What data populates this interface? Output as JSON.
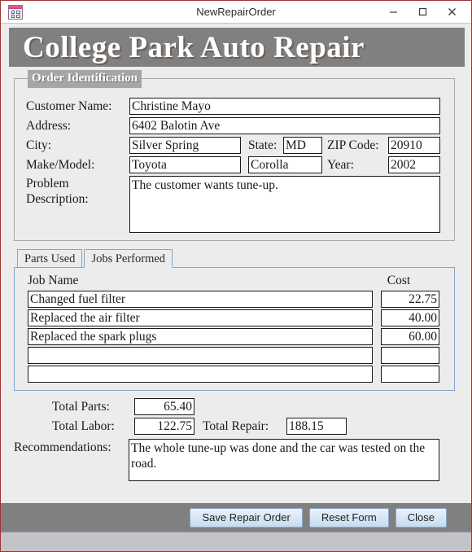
{
  "window": {
    "title": "NewRepairOrder",
    "icon": "form-window-icon",
    "border_color": "#9c3333",
    "controls": [
      {
        "name": "minimize-button",
        "glyph": "minimize"
      },
      {
        "name": "maximize-button",
        "glyph": "maximize"
      },
      {
        "name": "close-button",
        "glyph": "close"
      }
    ]
  },
  "banner": {
    "title": "College Park Auto Repair",
    "background": "#808080",
    "text_color": "#ffffff"
  },
  "order_identification": {
    "legend": "Order Identification",
    "fields": {
      "customer_name": {
        "label": "Customer Name:",
        "value": "Christine Mayo"
      },
      "address": {
        "label": "Address:",
        "value": "6402 Balotin Ave"
      },
      "city": {
        "label": "City:",
        "value": "Silver Spring"
      },
      "state": {
        "label": "State:",
        "value": "MD"
      },
      "zip_code": {
        "label": "ZIP Code:",
        "value": "20910"
      },
      "make_model": {
        "label": "Make/Model:",
        "make": "Toyota",
        "model": "Corolla"
      },
      "year": {
        "label": "Year:",
        "value": "2002"
      },
      "problem_description": {
        "label_line1": "Problem",
        "label_line2": "Description:",
        "value": "The customer wants tune-up."
      }
    }
  },
  "tabs": {
    "items": [
      {
        "label": "Parts Used",
        "active": false
      },
      {
        "label": "Jobs Performed",
        "active": true
      }
    ],
    "border_color": "#7ea7cd"
  },
  "jobs_table": {
    "headers": {
      "name": "Job Name",
      "cost": "Cost"
    },
    "rows": [
      {
        "name": "Changed fuel filter",
        "cost": "22.75"
      },
      {
        "name": "Replaced the air filter",
        "cost": "40.00"
      },
      {
        "name": "Replaced the spark plugs",
        "cost": "60.00"
      },
      {
        "name": "",
        "cost": ""
      },
      {
        "name": "",
        "cost": ""
      }
    ]
  },
  "totals": {
    "total_parts": {
      "label": "Total Parts:",
      "value": "65.40"
    },
    "total_labor": {
      "label": "Total Labor:",
      "value": "122.75"
    },
    "total_repair": {
      "label": "Total Repair:",
      "value": "188.15"
    }
  },
  "recommendations": {
    "label": "Recommendations:",
    "value": "The whole tune-up was done and the car was tested on the road."
  },
  "buttons": {
    "save": "Save Repair Order",
    "reset": "Reset Form",
    "close": "Close"
  }
}
